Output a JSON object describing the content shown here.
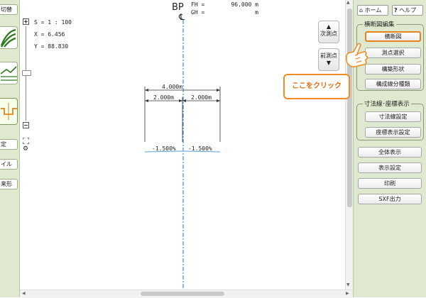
{
  "left_toolbar": {
    "top_button": "切替",
    "buttons": [
      "定",
      "イル",
      "来形"
    ]
  },
  "header": {
    "station": "BP",
    "centerline_symbol": "℄",
    "fh_label": "FH =",
    "fh_value": "96.000 m",
    "gh_label": "GH =",
    "gh_value": "m"
  },
  "coords": {
    "scale": "S = 1 : 100",
    "x": "X = 6.456",
    "y": "Y = 88.830"
  },
  "zoom": {
    "plus": "+",
    "minus": "−",
    "fit_icon": "expand-icon",
    "settings_icon": "gear-icon"
  },
  "nav": {
    "next_label": "次測点",
    "prev_label": "前測点"
  },
  "drawing": {
    "total_width": "4.000m",
    "left_width": "2.000m",
    "right_width": "2.000m",
    "left_slope": "-1.500%",
    "right_slope": "-1.500%"
  },
  "right_panel": {
    "home_label": "ホーム",
    "help_label": "ヘルプ",
    "group1_title": "横断図編集",
    "group1_buttons": [
      "横断図",
      "測点選択",
      "構築形状",
      "構成線分種類"
    ],
    "group2_title": "寸法線･座標表示",
    "group2_buttons": [
      "寸法線設定",
      "座標表示設定"
    ],
    "bottom_buttons": [
      "全体表示",
      "表示設定",
      "印刷",
      "SXF出力"
    ]
  },
  "callout_text": "ここをクリック",
  "colors": {
    "panel_bg": "#dfe9cf",
    "accent_orange": "#f28c22",
    "centerline": "#1f6fd0"
  }
}
